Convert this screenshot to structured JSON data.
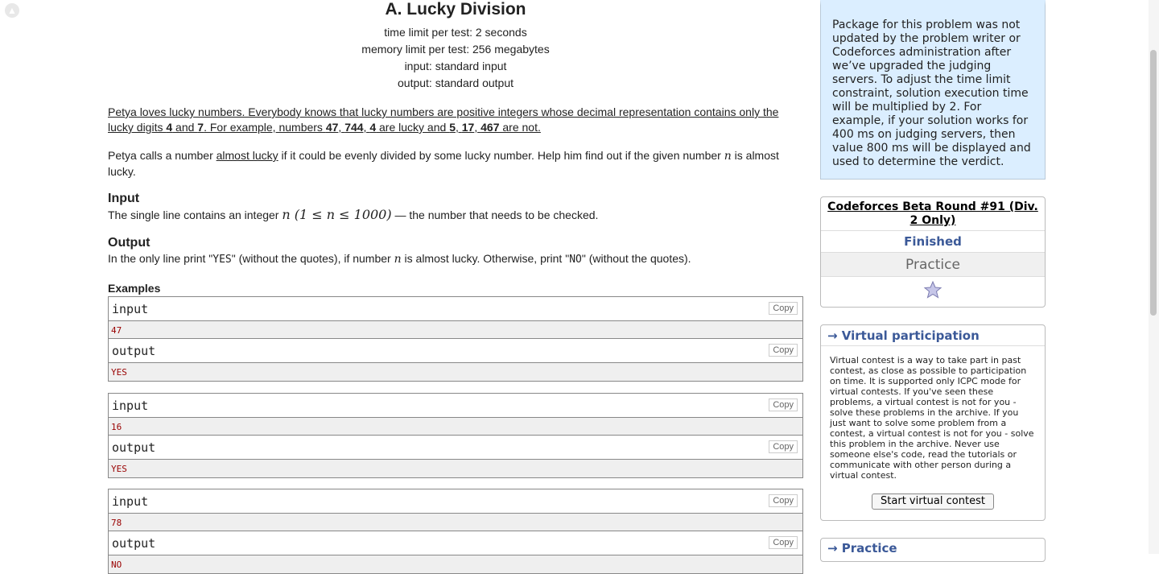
{
  "problem": {
    "title": "A. Lucky Division",
    "time_limit": "time limit per test: 2 seconds",
    "memory_limit": "memory limit per test: 256 megabytes",
    "input_file": "input: standard input",
    "output_file": "output: standard output",
    "p1_a": "Petya loves lucky numbers. Everybody knows that lucky numbers are positive integers whose decimal representation contains only the lucky digits ",
    "p1_d1": "4",
    "p1_b": " and ",
    "p1_d2": "7",
    "p1_c": ". For example, numbers ",
    "p1_n1": "47",
    "p1_s1": ", ",
    "p1_n2": "744",
    "p1_s2": ", ",
    "p1_n3": "4",
    "p1_d": " are lucky and ",
    "p1_n4": "5",
    "p1_s3": ", ",
    "p1_n5": "17",
    "p1_s4": ", ",
    "p1_n6": "467",
    "p1_e": " are not.",
    "p2_a": "Petya calls a number ",
    "p2_link": "almost lucky",
    "p2_b": " if it could be evenly divided by some lucky number. Help him find out if the given number ",
    "p2_var": "n",
    "p2_c": " is almost lucky.",
    "input_heading": "Input",
    "input_a": "The single line contains an integer ",
    "input_math": "n (1 ≤ n ≤ 1000)",
    "input_b": " — the number that needs to be checked.",
    "output_heading": "Output",
    "output_a": "In the only line print \"",
    "output_yes": "YES",
    "output_b": "\" (without the quotes), if number ",
    "output_var": "n",
    "output_c": " is almost lucky. Otherwise, print \"",
    "output_no": "NO",
    "output_d": "\" (without the quotes).",
    "examples_heading": "Examples",
    "input_label": "input",
    "output_label": "output",
    "copy_label": "Copy",
    "examples": [
      {
        "input": "47",
        "output": "YES"
      },
      {
        "input": "16",
        "output": "YES"
      },
      {
        "input": "78",
        "output": "NO"
      }
    ]
  },
  "sidebar": {
    "note": "Package for this problem was not updated by the problem writer or Codeforces administration after we’ve upgraded the judging servers. To adjust the time limit constraint, solution execution time will be multiplied by 2. For example, if your solution works for 400 ms on judging servers, then value 800 ms will be displayed and used to determine the verdict.",
    "contest_name": "Codeforces Beta Round #91 (Div. 2 Only)",
    "contest_phase": "Finished",
    "contest_mode": "Practice",
    "virtual_heading": "→ Virtual participation",
    "virtual_text": "Virtual contest is a way to take part in past contest, as close as possible to participation on time. It is supported only ICPC mode for virtual contests. If you've seen these problems, a virtual contest is not for you - solve these problems in the archive. If you just want to solve some problem from a contest, a virtual contest is not for you - solve this problem in the archive. Never use someone else's code, read the tutorials or communicate with other person during a virtual contest.",
    "virtual_button": "Start virtual contest",
    "practice_heading": "→ Practice"
  },
  "colors": {
    "accent": "#3b5998",
    "note_bg": "#dbeeff",
    "example_value": "#990000"
  }
}
